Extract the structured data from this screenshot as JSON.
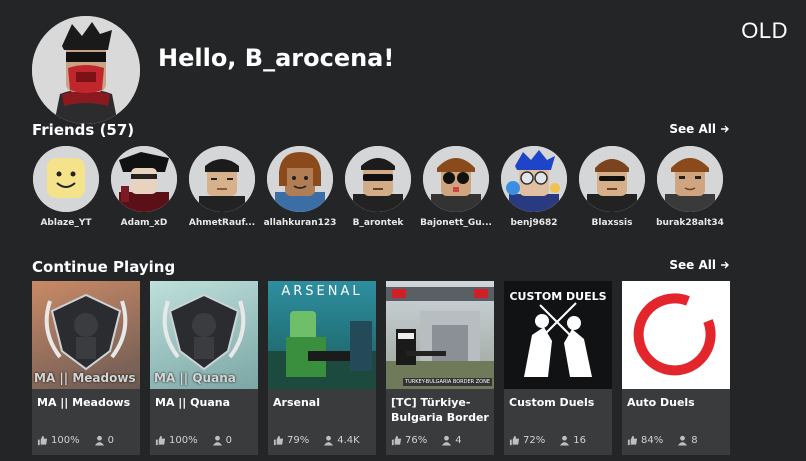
{
  "corner_label": "OLD",
  "greeting": "Hello, B_arocena!",
  "friends": {
    "title": "Friends (57)",
    "see_all": "See All",
    "items": [
      {
        "name": "Ablaze_YT"
      },
      {
        "name": "Adam_xD"
      },
      {
        "name": "AhmetRauf..."
      },
      {
        "name": "allahkuran123"
      },
      {
        "name": "B_arontek"
      },
      {
        "name": "Bajonett_Gu..."
      },
      {
        "name": "benj9682"
      },
      {
        "name": "Blaxssis"
      },
      {
        "name": "burak28alt34"
      }
    ]
  },
  "continue_playing": {
    "title": "Continue Playing",
    "see_all": "See All",
    "games": [
      {
        "title": "MA || Meadows",
        "thumb_text": "MA || Meadows",
        "rating": "100%",
        "players": "0"
      },
      {
        "title": "MA || Quana",
        "thumb_text": "MA || Quana",
        "rating": "100%",
        "players": "0"
      },
      {
        "title": "Arsenal",
        "thumb_text": "ARSENAL",
        "rating": "79%",
        "players": "4.4K"
      },
      {
        "title": "[TC] Türkiye-Bulgaria Border",
        "thumb_text": "TURKEY-BULGARIA BORDER ZONE",
        "rating": "76%",
        "players": "4"
      },
      {
        "title": "Custom Duels",
        "thumb_text": "CUSTOM DUELS",
        "rating": "72%",
        "players": "16"
      },
      {
        "title": "Auto Duels",
        "thumb_text": "",
        "rating": "84%",
        "players": "8"
      }
    ]
  },
  "colors": {
    "background": "#232527",
    "card": "#393b3d",
    "auto_duels_ring": "#e3262b"
  }
}
